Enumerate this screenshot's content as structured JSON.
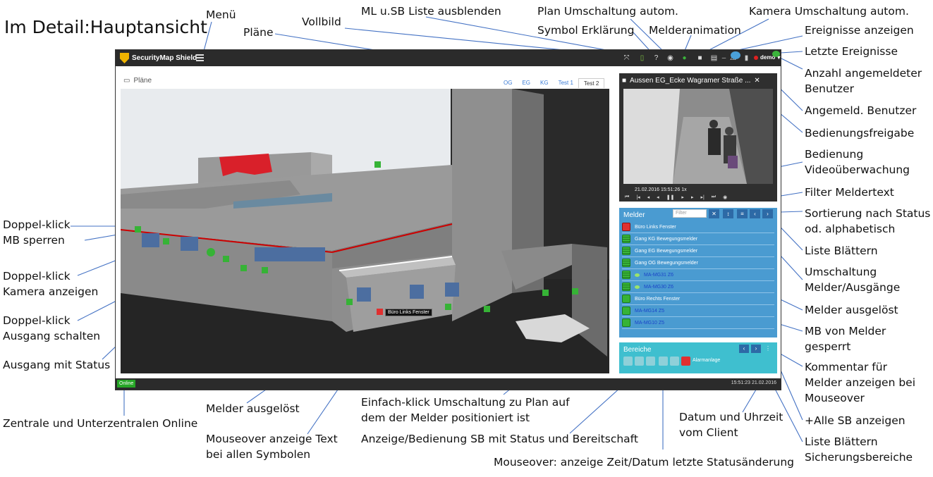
{
  "title": "Im Detail:Hauptansicht",
  "app": {
    "brand": "SecurityMap Shield",
    "user": "demo",
    "plans_header": "Pläne",
    "tabs": [
      "OG",
      "EG",
      "KG",
      "Test 1",
      "Test 2"
    ],
    "active_tab": "Test 2",
    "tooltip": "Büro Links Fenster",
    "camera": {
      "title": "Aussen EG_Ecke Wagramer Straße ...",
      "timestamp": "21.02.2016 15:51:26",
      "speed": "1x"
    },
    "melder": {
      "title": "Melder",
      "filter_placeholder": "Filter",
      "items": [
        {
          "label": "Büro Links Fenster",
          "state": "alarm",
          "comment": false,
          "blue": false
        },
        {
          "label": "Gang KG Bewegungsmelder",
          "state": "blocked",
          "comment": false,
          "blue": false
        },
        {
          "label": "Gang EG Bewegungsmelder",
          "state": "blocked",
          "comment": false,
          "blue": false
        },
        {
          "label": "Gang OG Bewegungsmelder",
          "state": "blocked",
          "comment": false,
          "blue": false
        },
        {
          "label": "MA-MG31 Z6",
          "state": "blocked",
          "comment": true,
          "blue": true
        },
        {
          "label": "MA-MG30 Z6",
          "state": "blocked",
          "comment": true,
          "blue": true
        },
        {
          "label": "Büro Rechts Fenster",
          "state": "ok",
          "comment": false,
          "blue": false
        },
        {
          "label": "MA-MG14 Z5",
          "state": "ok",
          "comment": false,
          "blue": true
        },
        {
          "label": "MA-MG10 Z5",
          "state": "ok",
          "comment": false,
          "blue": true
        }
      ]
    },
    "bereiche": {
      "title": "Bereiche",
      "alarm_label": "Alarmanlage"
    },
    "status": {
      "online": "Online",
      "datetime": "15:51:23 21.02.2016"
    }
  },
  "labels": {
    "menu": "Menü",
    "plaene": "Pläne",
    "vollbild": "Vollbild",
    "ml_sb": "ML u.SB Liste ausblenden",
    "plan_umsch": "Plan Umschaltung autom.",
    "symbol": "Symbol Erklärung",
    "melderanim": "Melderanimation",
    "kamera_umsch": "Kamera Umschaltung autom.",
    "ereignisse": "Ereignisse anzeigen",
    "letzte": "Letzte Ereignisse",
    "anzahl1": "Anzahl angemeldeter",
    "anzahl2": "Benutzer",
    "angemeld": "Angemeld. Benutzer",
    "bedfreigabe": "Bedienungsfreigabe",
    "bedvideo1": "Bedienung",
    "bedvideo2": "Videoüberwachung",
    "filter": "Filter Meldertext",
    "sort1": "Sortierung  nach Status",
    "sort2": "od. alphabetisch",
    "blaettern": "Liste Blättern",
    "umsch1": "Umschaltung",
    "umsch2": "Melder/Ausgänge",
    "ausgeloest": "Melder ausgelöst",
    "mb1": "MB von Melder",
    "mb2": "gesperrt",
    "komm1": "Kommentar für",
    "komm2": "Melder anzeigen bei",
    "komm3": "Mouseover",
    "allesb": "+Alle SB anzeigen",
    "sb_blaettern1": "Liste Blättern",
    "sb_blaettern2": "Sicherungsbereiche",
    "dk_mb1": "Doppel-klick",
    "dk_mb2": "MB sperren",
    "dk_kam1": "Doppel-klick",
    "dk_kam2": "Kamera anzeigen",
    "dk_aus1": "Doppel-klick",
    "dk_aus2": "Ausgang schalten",
    "ausgang_status": "Ausgang mit Status",
    "zentrale": "Zentrale und Unterzentralen Online",
    "melder_ausgeloest_b": "Melder ausgelöst",
    "mouseover1": "Mouseover anzeige Text",
    "mouseover2": "bei allen Symbolen",
    "einfach1": "Einfach-klick Umschaltung zu Plan auf",
    "einfach2": "dem der Melder positioniert ist",
    "anzeige_sb": "Anzeige/Bedienung SB mit Status und  Bereitschaft",
    "mouseover_zeit": "Mouseover: anzeige Zeit/Datum letzte Statusänderung",
    "datum1": "Datum und Uhrzeit",
    "datum2": "vom Client"
  }
}
